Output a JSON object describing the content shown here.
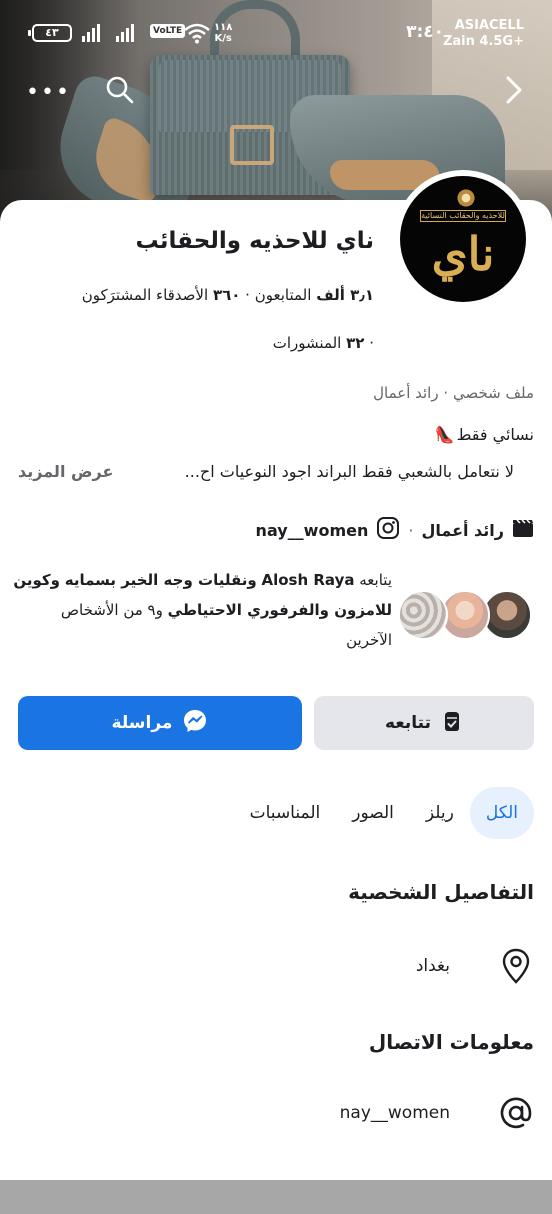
{
  "status_bar": {
    "carrier_1": "ASIACELL",
    "carrier_2": "Zain 4.5G+",
    "time": "٣:٤٠",
    "battery": "٤٣",
    "volte": "VoLTE",
    "speed_value": "١١٨",
    "speed_unit": "K/s"
  },
  "cover": {
    "back_icon": "chevron-right-icon",
    "search_icon": "search-icon",
    "more_label": "•••"
  },
  "profile": {
    "name": "ناي للاحذيه والحقائب",
    "followers_count": "٣٫١ ألف",
    "followers_label": "المتابعون",
    "following_count": "٣٦٠",
    "following_label": "الأصدقاء المشترَكون",
    "posts_count": "٣٢",
    "posts_label": "المنشورات",
    "profile_type": "ملف شخصي",
    "category": "رائد أعمال",
    "avatar_tag": "للاحذيه والحقائب النسائية",
    "avatar_logo": "ناي"
  },
  "bio": {
    "line1": "نسائي فقط",
    "line1_emoji": "👠",
    "line2": "لا نتعامل بالشعبي فقط البراند اجود النوعيات اح...",
    "see_more": "عرض المزيد"
  },
  "links": {
    "category": "رائد أعمال",
    "instagram": "nay__women"
  },
  "mutual": {
    "prefix": "يتابعه",
    "name1": "Alosh Raya",
    "middle": "ونقليات وجه الخير بسمايه",
    "name2": "وكوين للامزون والفرفوري الاحتياطي",
    "suffix": "و٩ من الأشخاص الآخرين"
  },
  "actions": {
    "follow": "تتابعه",
    "message": "مراسلة"
  },
  "tabs": [
    "الكل",
    "ريلز",
    "الصور",
    "المناسبات"
  ],
  "details": {
    "title": "التفاصيل الشخصية",
    "location": "بغداد"
  },
  "contact": {
    "title": "معلومات الاتصال",
    "instagram": "nay__women"
  },
  "colors": {
    "accent": "#1b74e4",
    "secondary_button": "#e4e6eb",
    "active_tab_bg": "#e7f0fd",
    "muted_text": "#65676b"
  }
}
